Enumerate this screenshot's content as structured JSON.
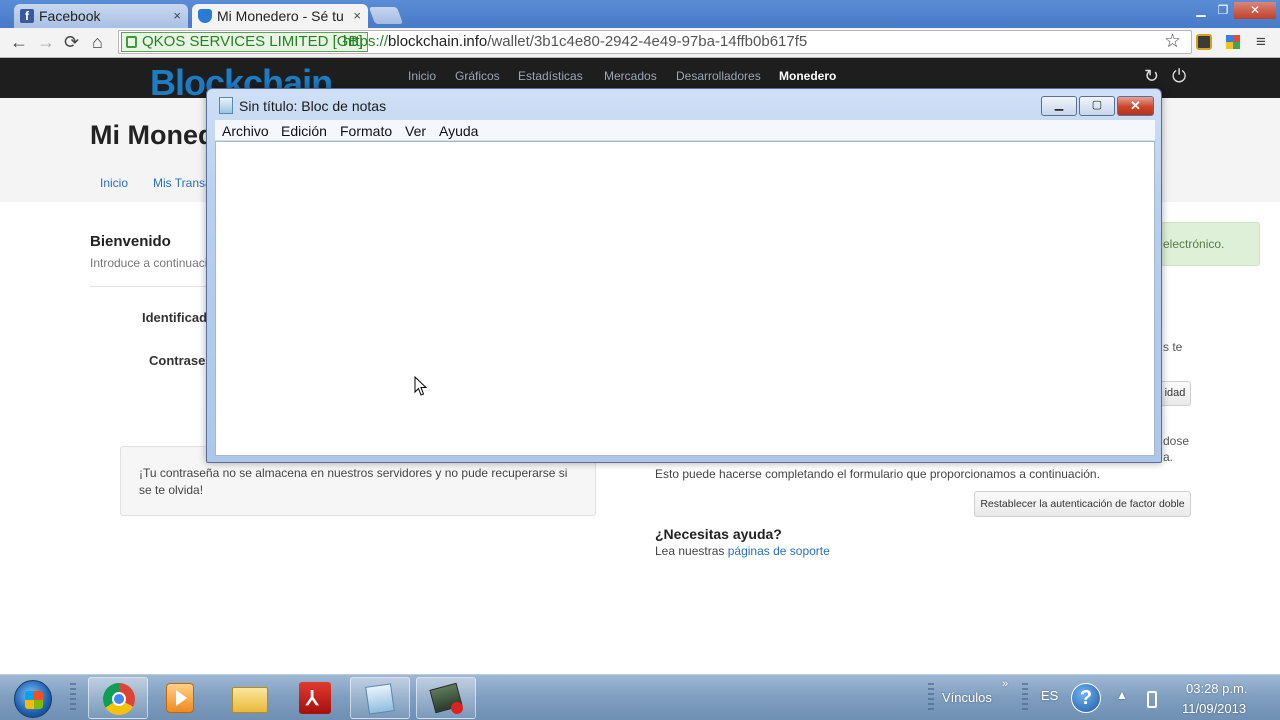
{
  "browser": {
    "tabs": [
      {
        "title": "Facebook",
        "close": "×"
      },
      {
        "title": "Mi Monedero - Sé tu",
        "close": "×"
      }
    ],
    "window_controls": {
      "minimize": "▁",
      "restore": "❐",
      "close": "✕"
    },
    "ev_org": "QKOS SERVICES LIMITED [GB]",
    "url": {
      "scheme": "https://",
      "host": "blockchain.info",
      "path": "/wallet/3b1c4e80-2942-4e49-97ba-14ffb0b617f5"
    }
  },
  "site": {
    "logo": "Blockchain",
    "nav": [
      "Inicio",
      "Gráficos",
      "Estadísticas",
      "Mercados",
      "Desarrolladores",
      "Monedero"
    ],
    "nav_active": "Monedero",
    "page_title": "Mi Monedero",
    "subnav": [
      "Inicio",
      "Mis Transacciones"
    ],
    "welcome_title": "Bienvenido",
    "welcome_sub": "Introduce a continuación",
    "identifier_label": "Identificador",
    "password_label": "Contraseña",
    "notice": "¡Tu contraseña no se almacena en nuestros servidores y no pude recuperarse si se te olvida!",
    "green_box": "electrónico.",
    "right_fragment_1": "s te",
    "button_partial": "idad",
    "right_fragment_2": "dose",
    "right_fragment_3": "a.",
    "reset_text": "Esto puede hacerse completando el formulario que proporcionamos a continuación.",
    "reset_button": "Restablecer la autenticación de factor doble",
    "help_title": "¿Necesitas ayuda?",
    "help_text": "Lea nuestras",
    "help_link": "páginas de soporte"
  },
  "notepad": {
    "title": "Sin título: Bloc de notas",
    "menu": [
      "Archivo",
      "Edición",
      "Formato",
      "Ver",
      "Ayuda"
    ],
    "content": ""
  },
  "taskbar": {
    "toolbar_label": "Vínculos",
    "language": "ES",
    "time": "03:28 p.m.",
    "date": "11/09/2013"
  }
}
